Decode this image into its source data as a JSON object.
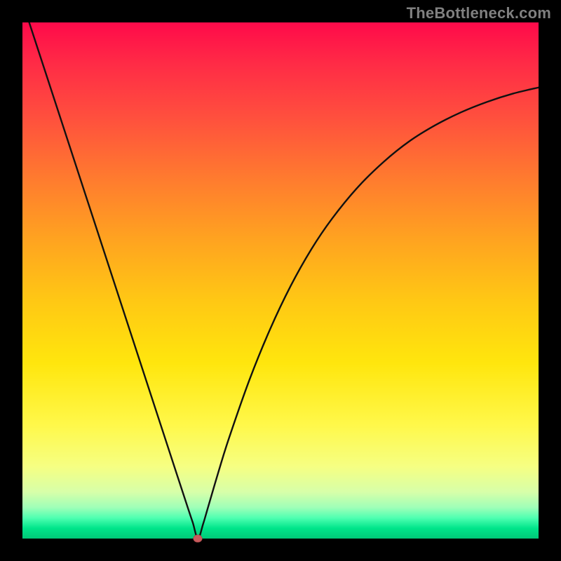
{
  "attribution": "TheBottleneck.com",
  "colors": {
    "frame": "#000000",
    "curve_stroke": "#111111",
    "marker_fill": "#c95b5d",
    "watermark": "#808080"
  },
  "chart_data": {
    "type": "line",
    "title": "",
    "xlabel": "",
    "ylabel": "",
    "xlim": [
      0,
      100
    ],
    "ylim": [
      0,
      100
    ],
    "grid": false,
    "legend": false,
    "annotations": [
      {
        "type": "marker",
        "x": 34,
        "y": 0
      }
    ],
    "series": [
      {
        "name": "bottleneck-curve",
        "x": [
          0,
          5,
          10,
          15,
          20,
          25,
          30,
          32,
          33,
          34,
          35,
          36,
          38,
          40,
          44,
          48,
          52,
          56,
          60,
          65,
          70,
          75,
          80,
          85,
          90,
          95,
          100
        ],
        "values": [
          104,
          88.7,
          73.4,
          58.1,
          42.8,
          27.5,
          12.2,
          6.1,
          3.1,
          0.0,
          2.8,
          6.2,
          13.0,
          19.4,
          30.8,
          40.6,
          49.0,
          56.1,
          62.0,
          68.1,
          73.0,
          77.0,
          80.1,
          82.6,
          84.6,
          86.2,
          87.4
        ]
      }
    ]
  }
}
